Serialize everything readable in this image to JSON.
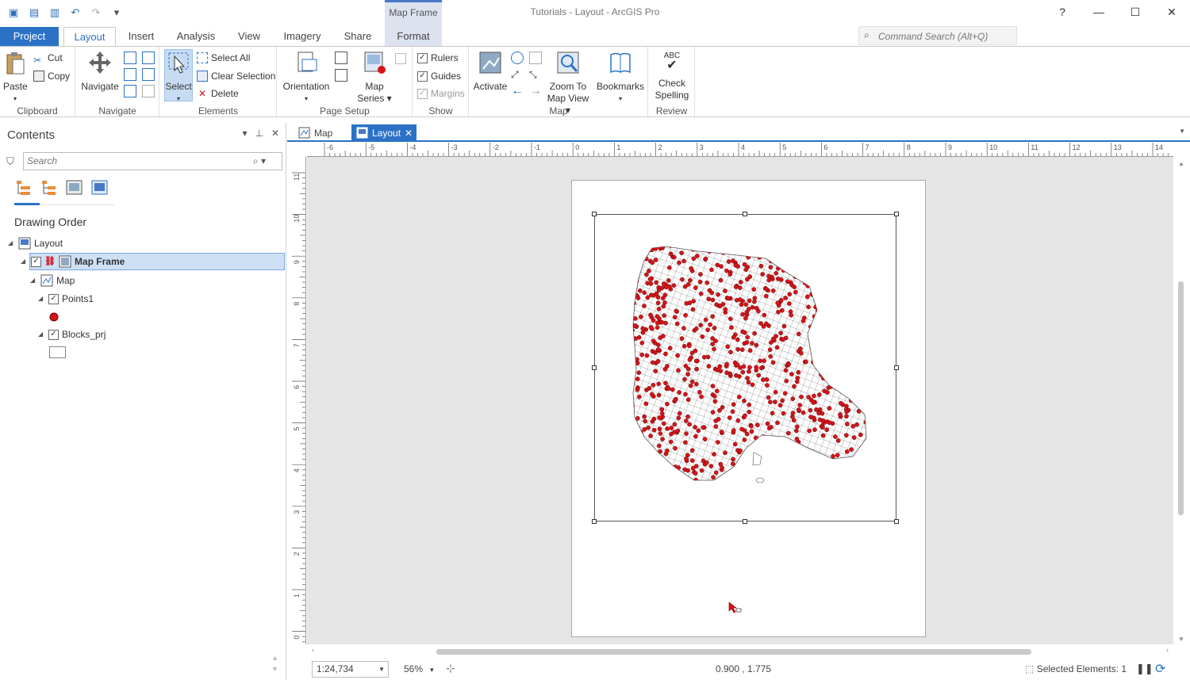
{
  "app": {
    "title": "Tutorials - Layout - ArcGIS Pro",
    "contextual_group": "Map Frame"
  },
  "window_controls": {
    "help": "?",
    "minimize": "—",
    "maximize": "☐",
    "close": "✕"
  },
  "tabs": [
    "Project",
    "Layout",
    "Insert",
    "Analysis",
    "View",
    "Imagery",
    "Share",
    "Format"
  ],
  "command_search": {
    "placeholder": "Command Search (Alt+Q)"
  },
  "ribbon": {
    "clipboard": {
      "label": "Clipboard",
      "paste": "Paste",
      "cut": "Cut",
      "copy": "Copy"
    },
    "navigate": {
      "label": "Navigate",
      "navigate": "Navigate"
    },
    "elements": {
      "label": "Elements",
      "select": "Select",
      "select_all": "Select All",
      "clear_selection": "Clear Selection",
      "delete": "Delete"
    },
    "page_setup": {
      "label": "Page Setup",
      "orientation": "Orientation",
      "map_series_line1": "Map",
      "map_series_line2": "Series"
    },
    "show": {
      "label": "Show",
      "rulers": "Rulers",
      "guides": "Guides",
      "margins": "Margins"
    },
    "map": {
      "label": "Map",
      "activate": "Activate",
      "zoom_line1": "Zoom To",
      "zoom_line2": "Map View",
      "bookmarks": "Bookmarks"
    },
    "review": {
      "label": "Review",
      "check_line1": "Check",
      "check_line2": "Spelling",
      "abc": "ABC"
    }
  },
  "contents": {
    "title": "Contents",
    "search_placeholder": "Search",
    "section": "Drawing Order",
    "tree": {
      "layout": "Layout",
      "map_frame": "Map Frame",
      "map": "Map",
      "points": "Points1",
      "blocks": "Blocks_prj"
    }
  },
  "view_tabs": {
    "map": "Map",
    "layout": "Layout"
  },
  "ruler": {
    "horizontal": [
      "-6",
      "-5",
      "-4",
      "-3",
      "-2",
      "-1",
      "0",
      "1",
      "2",
      "3",
      "4",
      "5",
      "6",
      "7",
      "8",
      "9",
      "10",
      "11",
      "12",
      "13",
      "14"
    ],
    "vertical": [
      "11",
      "10",
      "9",
      "8",
      "7",
      "6",
      "5",
      "4",
      "3",
      "2",
      "1",
      "0"
    ]
  },
  "status": {
    "scale": "1:24,734",
    "zoom": "56%",
    "coords": "0.900 , 1.775",
    "selected": "Selected Elements: 1"
  },
  "colors": {
    "accent": "#2b72c7",
    "points": "#d4151a",
    "selection": "#cde0f5"
  }
}
